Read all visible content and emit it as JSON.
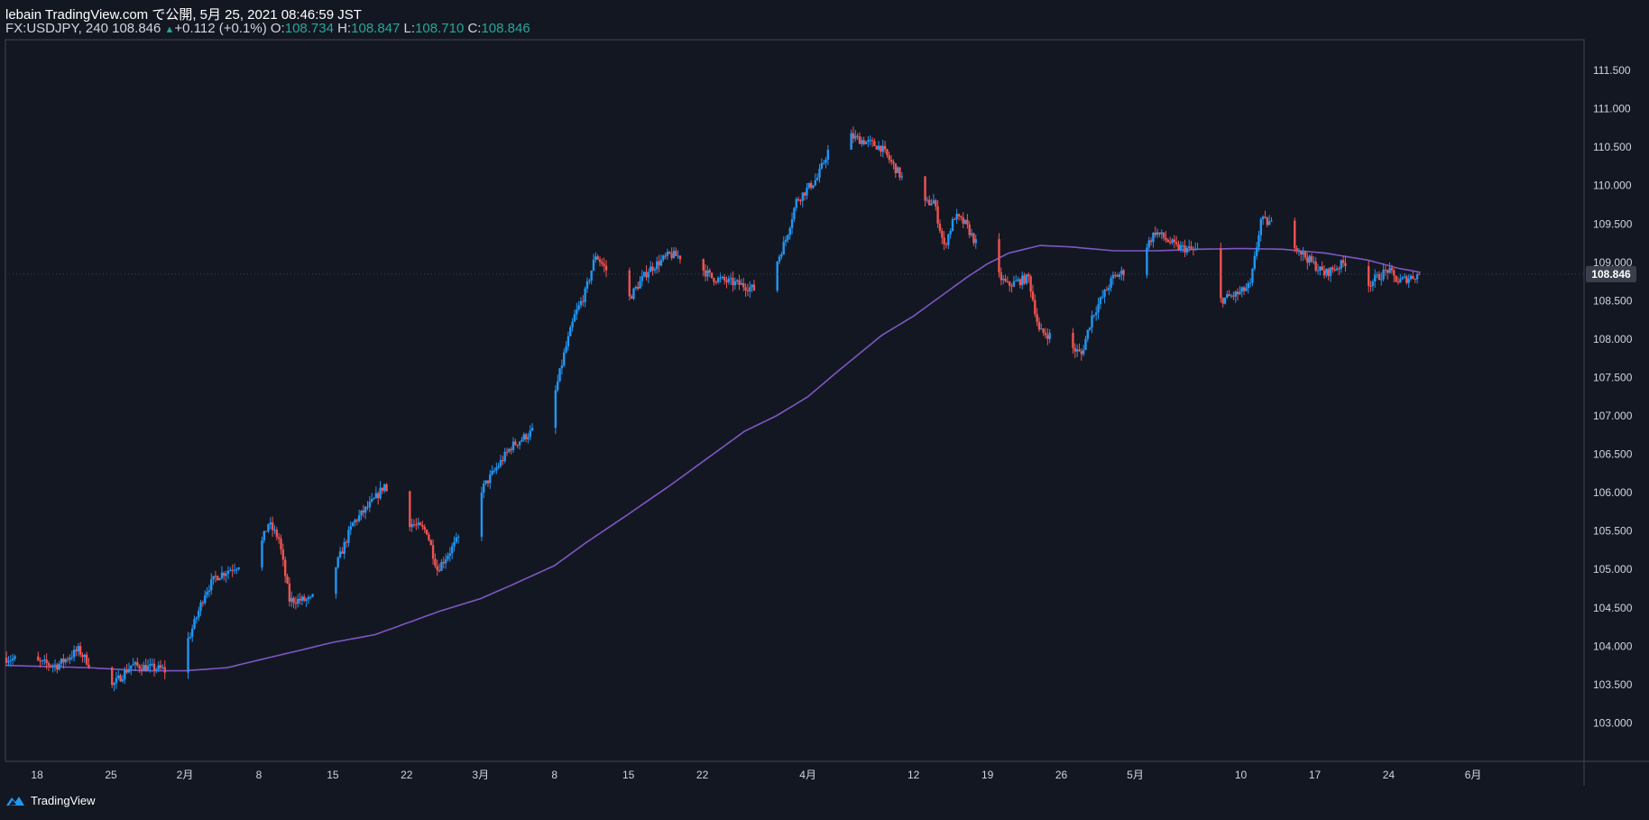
{
  "header": {
    "line1": "lebain TradingView.com で公開, 5月 25, 2021 08:46:59 JST",
    "symbol": "FX:USDJPY, 240",
    "last": "108.846",
    "change": "+0.112 (+0.1%)",
    "o_label": "O:",
    "o_val": "108.734",
    "h_label": "H:",
    "h_val": "108.847",
    "l_label": "L:",
    "l_val": "108.710",
    "c_label": "C:",
    "c_val": "108.846"
  },
  "footer": {
    "brand": "TradingView",
    "logo_icon": "tradingview-logo-icon"
  },
  "colors": {
    "background": "#131722",
    "up": "#2196f3",
    "down": "#ef5350",
    "ma": "#7e57c2",
    "axis_text": "#d1d4dc",
    "grid_border": "#434651",
    "change_up": "#26a69a"
  },
  "chart_data": {
    "type": "candlestick",
    "ylim": [
      102.5,
      111.9
    ],
    "yticks": [
      "103.000",
      "103.500",
      "104.000",
      "104.500",
      "105.000",
      "105.500",
      "106.000",
      "106.500",
      "107.000",
      "107.500",
      "108.000",
      "108.500",
      "109.000",
      "109.500",
      "110.000",
      "110.500",
      "111.000",
      "111.500"
    ],
    "ytick_values": [
      103.0,
      103.5,
      104.0,
      104.5,
      105.0,
      105.5,
      106.0,
      106.5,
      107.0,
      107.5,
      108.0,
      108.5,
      109.0,
      109.5,
      110.0,
      110.5,
      111.0,
      111.5
    ],
    "current_price_label": "108.846",
    "current_price": 108.846,
    "x_labels": [
      "18",
      "25",
      "2月",
      "8",
      "15",
      "22",
      "3月",
      "8",
      "15",
      "22",
      "4月",
      "12",
      "19",
      "26",
      "5月",
      "10",
      "17",
      "24",
      "6月"
    ],
    "x_label_days": [
      0,
      7,
      14,
      21,
      28,
      35,
      42,
      49,
      56,
      63,
      73,
      83,
      90,
      97,
      104,
      114,
      121,
      128,
      136
    ],
    "x_range_days": [
      -3,
      146.5
    ],
    "last_day": 131,
    "price_path": [
      [
        -3,
        103.85
      ],
      [
        2,
        103.75
      ],
      [
        4,
        103.95
      ],
      [
        6,
        103.6
      ],
      [
        7,
        103.45
      ],
      [
        9,
        103.75
      ],
      [
        12,
        103.7
      ],
      [
        13,
        103.6
      ],
      [
        15,
        104.3
      ],
      [
        16,
        104.7
      ],
      [
        17,
        104.9
      ],
      [
        21,
        105.2
      ],
      [
        22,
        105.6
      ],
      [
        23,
        105.4
      ],
      [
        24,
        104.6
      ],
      [
        26,
        104.6
      ],
      [
        28,
        104.9
      ],
      [
        30,
        105.6
      ],
      [
        32,
        105.9
      ],
      [
        33,
        106.1
      ],
      [
        34,
        105.7
      ],
      [
        37,
        105.5
      ],
      [
        38,
        105.0
      ],
      [
        40,
        105.4
      ],
      [
        42,
        106.0
      ],
      [
        45,
        106.6
      ],
      [
        47,
        106.8
      ],
      [
        49,
        107.2
      ],
      [
        50,
        107.8
      ],
      [
        51,
        108.3
      ],
      [
        52,
        108.6
      ],
      [
        53,
        109.1
      ],
      [
        54,
        108.9
      ],
      [
        56,
        108.5
      ],
      [
        58,
        108.9
      ],
      [
        60,
        109.1
      ],
      [
        62,
        109.05
      ],
      [
        64,
        108.8
      ],
      [
        67,
        108.7
      ],
      [
        69,
        108.6
      ],
      [
        71,
        109.3
      ],
      [
        72,
        109.8
      ],
      [
        74,
        110.1
      ],
      [
        76,
        110.8
      ],
      [
        77,
        110.65
      ],
      [
        80,
        110.5
      ],
      [
        82,
        110.1
      ],
      [
        83,
        109.7
      ],
      [
        85,
        109.8
      ],
      [
        86,
        109.2
      ],
      [
        87,
        109.6
      ],
      [
        88,
        109.5
      ],
      [
        90,
        109.0
      ],
      [
        92,
        108.7
      ],
      [
        94,
        108.8
      ],
      [
        95,
        108.1
      ],
      [
        97,
        108.0
      ],
      [
        99,
        107.8
      ],
      [
        100,
        108.3
      ],
      [
        102,
        108.8
      ],
      [
        104,
        108.95
      ],
      [
        106,
        109.4
      ],
      [
        108,
        109.2
      ],
      [
        110,
        109.15
      ],
      [
        112,
        108.5
      ],
      [
        114,
        108.6
      ],
      [
        115,
        108.7
      ],
      [
        116,
        109.55
      ],
      [
        118,
        109.45
      ],
      [
        120,
        109.1
      ],
      [
        122,
        108.85
      ],
      [
        124,
        109.0
      ],
      [
        126,
        108.7
      ],
      [
        128,
        108.9
      ],
      [
        129,
        108.75
      ],
      [
        131,
        108.846
      ]
    ],
    "ma_series": [
      [
        -3,
        103.75
      ],
      [
        5,
        103.72
      ],
      [
        10,
        103.68
      ],
      [
        14,
        103.68
      ],
      [
        18,
        103.72
      ],
      [
        21,
        103.82
      ],
      [
        25,
        103.95
      ],
      [
        28,
        104.05
      ],
      [
        32,
        104.15
      ],
      [
        35,
        104.3
      ],
      [
        38,
        104.45
      ],
      [
        42,
        104.62
      ],
      [
        45,
        104.8
      ],
      [
        49,
        105.05
      ],
      [
        52,
        105.35
      ],
      [
        56,
        105.72
      ],
      [
        60,
        106.1
      ],
      [
        64,
        106.5
      ],
      [
        67,
        106.8
      ],
      [
        70,
        107.0
      ],
      [
        73,
        107.25
      ],
      [
        76,
        107.6
      ],
      [
        80,
        108.05
      ],
      [
        83,
        108.3
      ],
      [
        86,
        108.6
      ],
      [
        88,
        108.8
      ],
      [
        90,
        108.98
      ],
      [
        92,
        109.12
      ],
      [
        95,
        109.22
      ],
      [
        98,
        109.2
      ],
      [
        102,
        109.15
      ],
      [
        106,
        109.15
      ],
      [
        110,
        109.17
      ],
      [
        114,
        109.18
      ],
      [
        118,
        109.17
      ],
      [
        122,
        109.12
      ],
      [
        126,
        109.03
      ],
      [
        129,
        108.92
      ],
      [
        131,
        108.87
      ]
    ]
  }
}
